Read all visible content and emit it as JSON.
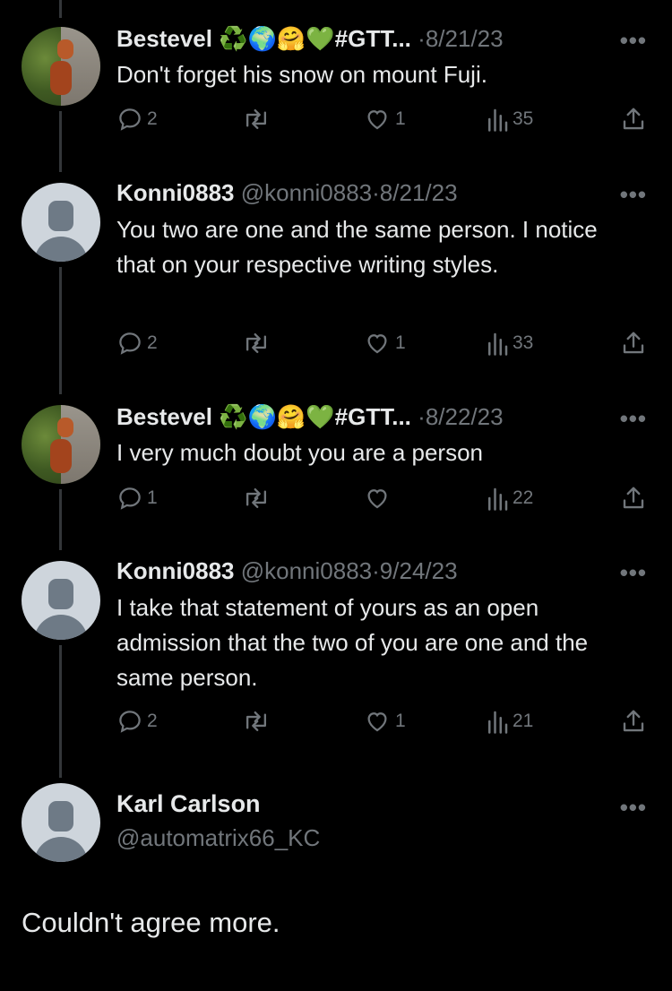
{
  "replies": [
    {
      "name": "Bestevel ♻️🌍🤗💚#GTT...",
      "handle": "",
      "sep": "·",
      "date": "8/21/23",
      "text": "Don't forget his snow on mount Fuji.",
      "replies_count": "2",
      "retweets_count": "",
      "likes_count": "1",
      "views_count": "35",
      "avatar": "red-panda-photo"
    },
    {
      "name": "Konni0883",
      "handle": "@konni0883",
      "sep": "·",
      "date": "8/21/23",
      "text": "You two are one and the same person. I notice that on your respective writing styles.",
      "replies_count": "2",
      "retweets_count": "",
      "likes_count": "1",
      "views_count": "33",
      "avatar": "default-avatar"
    },
    {
      "name": "Bestevel ♻️🌍🤗💚#GTT...",
      "handle": "",
      "sep": "·",
      "date": "8/22/23",
      "text": "I very much doubt you are a person",
      "replies_count": "1",
      "retweets_count": "",
      "likes_count": "",
      "views_count": "22",
      "avatar": "red-panda-photo"
    },
    {
      "name": "Konni0883",
      "handle": "@konni0883",
      "sep": "·",
      "date": "9/24/23",
      "text": "I take that statement of yours as an open admission that the two of you are one and the same person.",
      "replies_count": "2",
      "retweets_count": "",
      "likes_count": "1",
      "views_count": "21",
      "avatar": "default-avatar"
    }
  ],
  "main_tweet": {
    "name": "Karl Carlson",
    "handle": "@automatrix66_KC",
    "text": "Couldn't agree more.",
    "avatar": "default-avatar"
  },
  "more_label": "•••",
  "colors": {
    "background": "#000000",
    "text": "#e7e9ea",
    "muted": "#71767b",
    "thread_line": "#333639"
  }
}
